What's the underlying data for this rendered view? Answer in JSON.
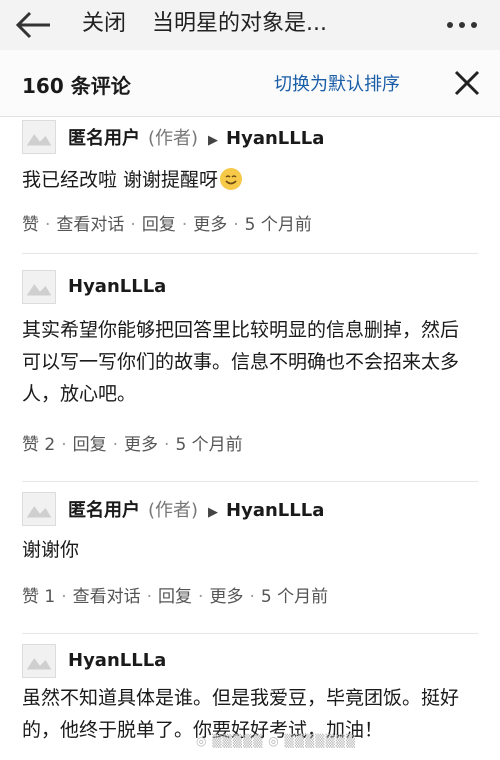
{
  "topbar": {
    "back_icon": "back-arrow-icon",
    "close_label": "关闭",
    "title": "当明星的对象是...",
    "more_icon": "more-dots-icon"
  },
  "comments_header": {
    "count": "160 条评论",
    "sort_toggle": "切换为默认排序",
    "close_icon": "close-x-icon"
  },
  "comments": [
    {
      "author": "匿名用户",
      "role": "(作者)",
      "reply_to": "HyanLLLa",
      "text": "我已经改啦 谢谢提醒呀",
      "emoji": "smile-emoji",
      "actions": [
        "赞",
        "查看对话",
        "回复",
        "更多",
        "5 个月前"
      ]
    },
    {
      "author": "HyanLLLa",
      "text": "其实希望你能够把回答里比较明显的信息删掉，然后可以写一写你们的故事。信息不明确也不会招来太多人，放心吧。",
      "actions": [
        "赞 2",
        "回复",
        "更多",
        "5 个月前"
      ]
    },
    {
      "author": "匿名用户",
      "role": "(作者)",
      "reply_to": "HyanLLLa",
      "text": "谢谢你",
      "actions": [
        "赞 1",
        "查看对话",
        "回复",
        "更多",
        "5 个月前"
      ]
    },
    {
      "author": "HyanLLLa",
      "text": "虽然不知道具体是谁。但是我爱豆，毕竟团饭。挺好的，他终于脱单了。你要好好考试，加油！"
    }
  ]
}
